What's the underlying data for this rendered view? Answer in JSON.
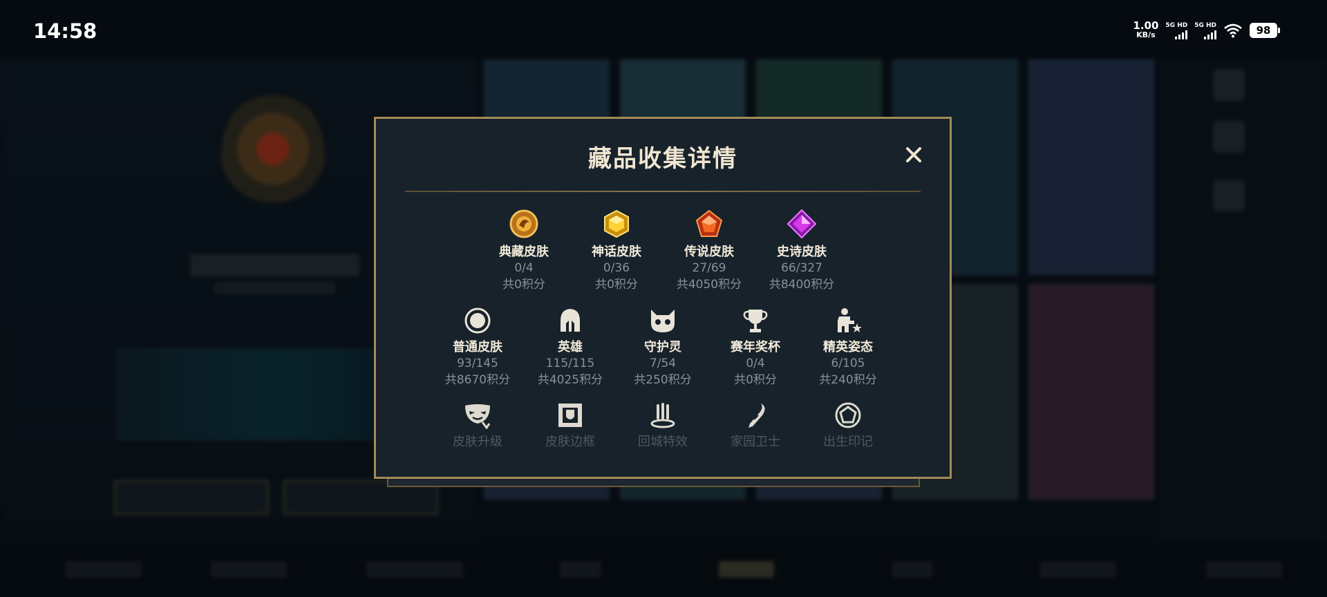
{
  "status_bar": {
    "time": "14:58",
    "net_speed": "1.00",
    "net_unit": "KB/s",
    "signal_1": "5G HD",
    "signal_2": "5G HD",
    "battery": "98"
  },
  "modal": {
    "title": "藏品收集详情",
    "close_icon": "close-icon",
    "rows": [
      [
        {
          "name": "典藏皮肤",
          "count": "0/4",
          "points": "共0积分",
          "icon": "gilded-skin-icon",
          "color": "#d99a2a"
        },
        {
          "name": "神话皮肤",
          "count": "0/36",
          "points": "共0积分",
          "icon": "mythic-skin-icon",
          "color": "#e3b21b"
        },
        {
          "name": "传说皮肤",
          "count": "27/69",
          "points": "共4050积分",
          "icon": "legendary-skin-icon",
          "color": "#e2561e"
        },
        {
          "name": "史诗皮肤",
          "count": "66/327",
          "points": "共8400积分",
          "icon": "epic-skin-icon",
          "color": "#c43ad9"
        }
      ],
      [
        {
          "name": "普通皮肤",
          "count": "93/145",
          "points": "共8670积分",
          "icon": "common-skin-icon"
        },
        {
          "name": "英雄",
          "count": "115/115",
          "points": "共4025积分",
          "icon": "champion-helmet-icon"
        },
        {
          "name": "守护灵",
          "count": "7/54",
          "points": "共250积分",
          "icon": "little-legend-icon"
        },
        {
          "name": "赛年奖杯",
          "count": "0/4",
          "points": "共0积分",
          "icon": "trophy-icon"
        },
        {
          "name": "精英姿态",
          "count": "6/105",
          "points": "共240积分",
          "icon": "elite-pose-icon"
        }
      ],
      [
        {
          "name": "皮肤升级",
          "icon": "skin-upgrade-mask-icon"
        },
        {
          "name": "皮肤边框",
          "icon": "skin-border-icon"
        },
        {
          "name": "回城特效",
          "icon": "recall-effect-icon"
        },
        {
          "name": "家园卫士",
          "icon": "home-guard-icon"
        },
        {
          "name": "出生印记",
          "icon": "birth-mark-icon"
        }
      ]
    ]
  }
}
